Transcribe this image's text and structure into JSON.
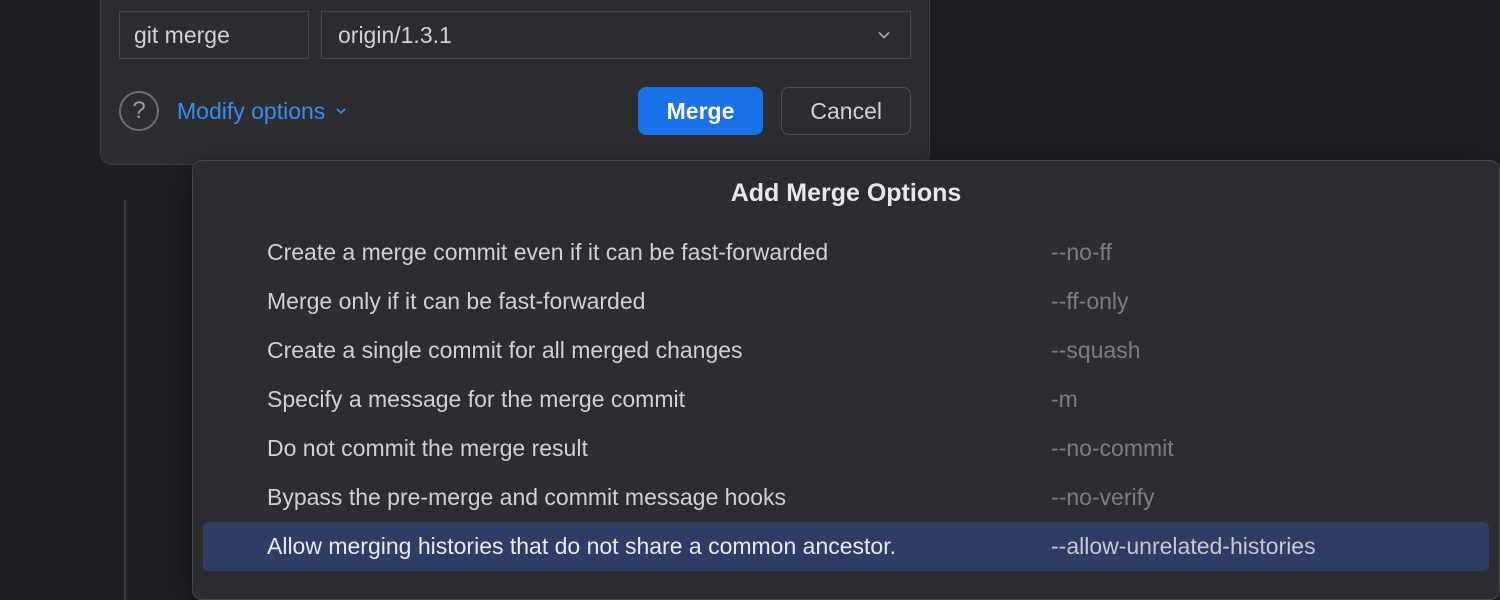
{
  "command": {
    "label": "git merge",
    "branch_value": "origin/1.3.1"
  },
  "actions": {
    "modify_options_label": "Modify options",
    "merge_button": "Merge",
    "cancel_button": "Cancel",
    "help_glyph": "?"
  },
  "popup": {
    "title": "Add Merge Options",
    "options": [
      {
        "desc": "Create a merge commit even if it can be fast-forwarded",
        "flag": "--no-ff",
        "selected": false
      },
      {
        "desc": "Merge only if it can be fast-forwarded",
        "flag": "--ff-only",
        "selected": false
      },
      {
        "desc": "Create a single commit for all merged changes",
        "flag": "--squash",
        "selected": false
      },
      {
        "desc": "Specify a message for the merge commit",
        "flag": "-m",
        "selected": false
      },
      {
        "desc": "Do not commit the merge result",
        "flag": "--no-commit",
        "selected": false
      },
      {
        "desc": "Bypass the pre-merge and commit message hooks",
        "flag": "--no-verify",
        "selected": false
      },
      {
        "desc": "Allow merging histories that do not share a common ancestor.",
        "flag": "--allow-unrelated-histories",
        "selected": true
      }
    ]
  }
}
